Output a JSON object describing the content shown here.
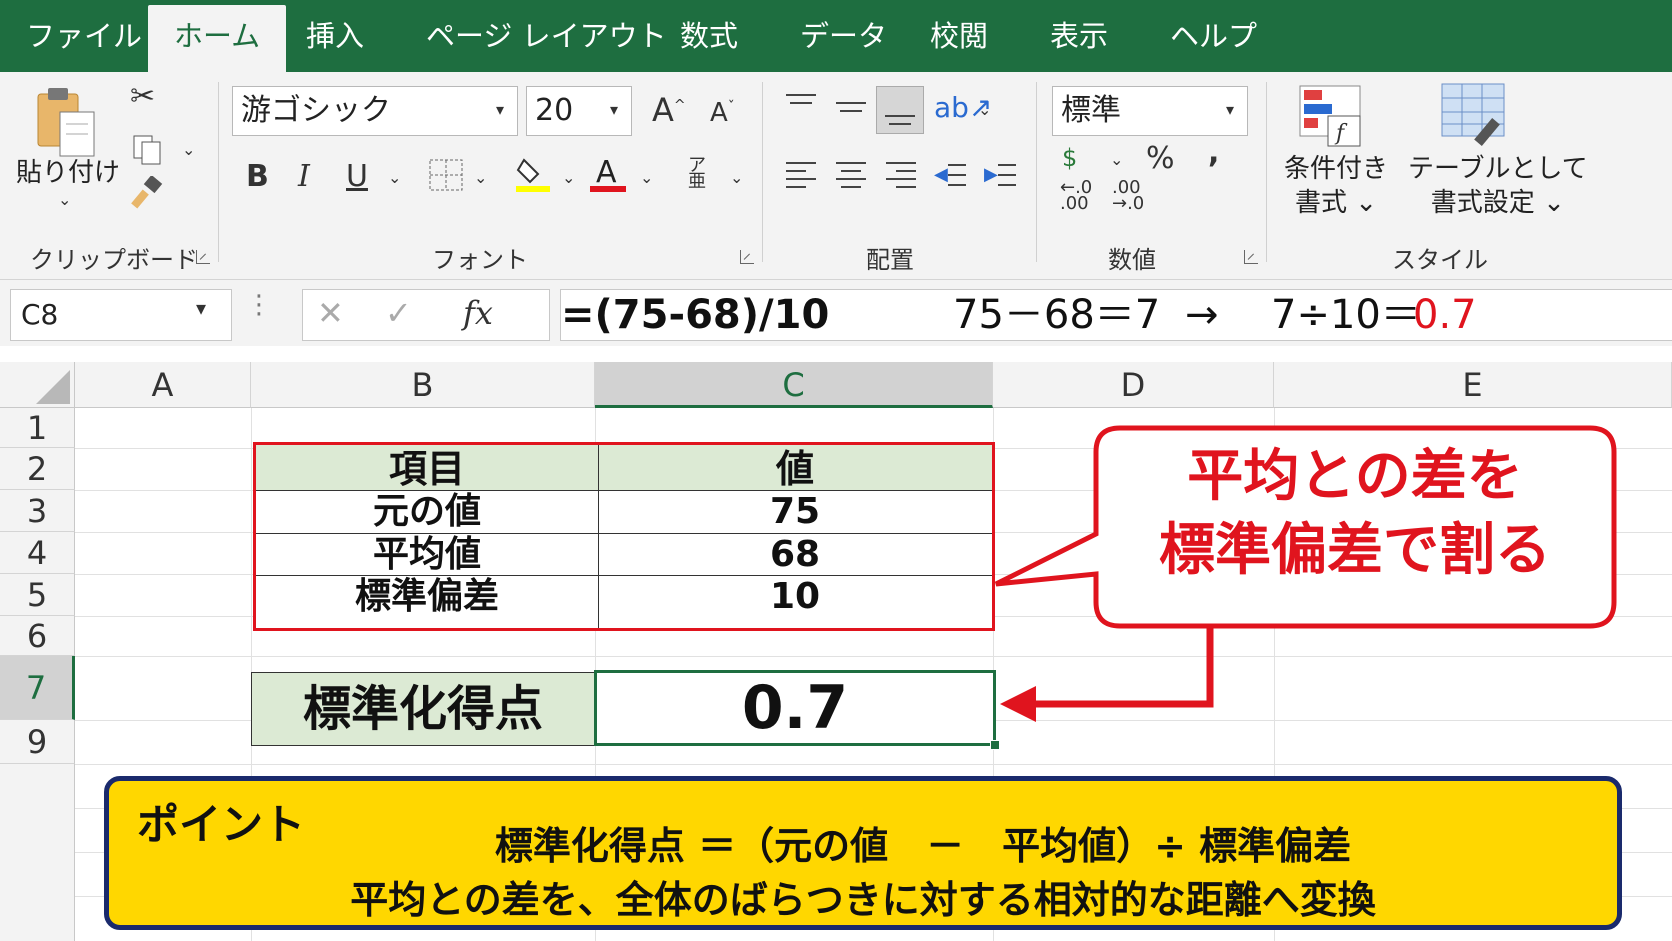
{
  "tabs": [
    "ファイル",
    "ホーム",
    "挿入",
    "ページ レイアウト",
    "数式",
    "データ",
    "校閲",
    "表示",
    "ヘルプ"
  ],
  "active_tab": "ホーム",
  "ribbon": {
    "clipboard": {
      "paste_label": "貼り付け",
      "group_label": "クリップボード"
    },
    "font": {
      "font_name": "游ゴシック",
      "font_size": "20",
      "bold": "B",
      "italic": "I",
      "underline": "U",
      "group_label": "フォント"
    },
    "alignment": {
      "group_label": "配置"
    },
    "number": {
      "format": "標準",
      "percent": "%",
      "comma": ",",
      "group_label": "数値"
    },
    "styles": {
      "conditional_line1": "条件付き",
      "conditional_line2": "書式",
      "table_line1": "テーブルとして",
      "table_line2": "書式設定",
      "group_label": "スタイル"
    }
  },
  "formula_bar": {
    "name_box": "C8",
    "fx": "fx",
    "formula": "=(75-68)/10",
    "annotation_calc": "75－68＝7",
    "annotation_arrow": "→",
    "annotation_result_prefix": "7÷10＝",
    "annotation_result": "0.7"
  },
  "columns": [
    "A",
    "B",
    "C",
    "D",
    "E"
  ],
  "rows": [
    "1",
    "2",
    "3",
    "4",
    "5",
    "6",
    "7",
    "9"
  ],
  "table": {
    "header": [
      "項目",
      "値"
    ],
    "rows": [
      [
        "元の値",
        "75"
      ],
      [
        "平均値",
        "68"
      ],
      [
        "標準偏差",
        "10"
      ]
    ]
  },
  "result": {
    "label": "標準化得点",
    "value": "0.7"
  },
  "callout": {
    "line1": "平均との差を",
    "line2": "標準偏差で割る"
  },
  "point_box": {
    "title": "ポイント",
    "formula": "標準化得点 ＝（元の値　－　平均値）÷ 標準偏差",
    "note": "平均との差を、全体のばらつきに対する相対的な距離へ変換"
  },
  "colors": {
    "excel_green": "#1e6e40",
    "header_fill": "#dcead4",
    "red": "#e0141e",
    "point_fill": "#ffd700",
    "point_border": "#1a2a6c"
  }
}
